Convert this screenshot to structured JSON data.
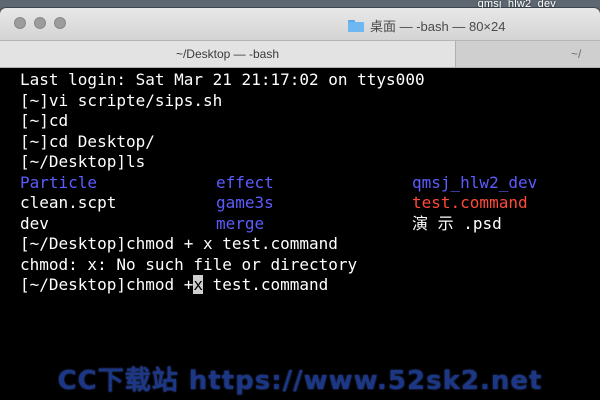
{
  "desktop": {
    "label": "qmsj_hlw2_dev"
  },
  "window": {
    "title": "桌面 — -bash — 80×24",
    "tabs": [
      {
        "label": "~/Desktop — -bash",
        "active": true
      },
      {
        "label": "~/",
        "active": false
      }
    ]
  },
  "terminal": {
    "lines": [
      "Last login: Sat Mar 21 21:17:02 on ttys000",
      "[~]vi scripte/sips.sh",
      "[~]cd",
      "[~]cd Desktop/",
      "[~/Desktop]ls"
    ],
    "listing": [
      {
        "name": "Particle",
        "color": "#5c5cff"
      },
      {
        "name": "effect",
        "color": "#5c5cff"
      },
      {
        "name": "qmsj_hlw2_dev",
        "color": "#5c5cff"
      },
      {
        "name": "clean.scpt",
        "color": "#ffffff"
      },
      {
        "name": "game3s",
        "color": "#5c5cff"
      },
      {
        "name": "test.command",
        "color": "#ff4a3a"
      },
      {
        "name": "dev",
        "color": "#ffffff"
      },
      {
        "name": "merge",
        "color": "#5c5cff"
      },
      {
        "name": "演 示 .psd",
        "color": "#ffffff"
      }
    ],
    "after": [
      "[~/Desktop]chmod + x test.command",
      "chmod: x: No such file or directory"
    ],
    "current": {
      "before_cursor": "[~/Desktop]chmod +",
      "cursor_char": "x",
      "after_cursor": " test.command"
    }
  },
  "watermark": {
    "text": "CC下载站 https://www.52sk2.net"
  }
}
